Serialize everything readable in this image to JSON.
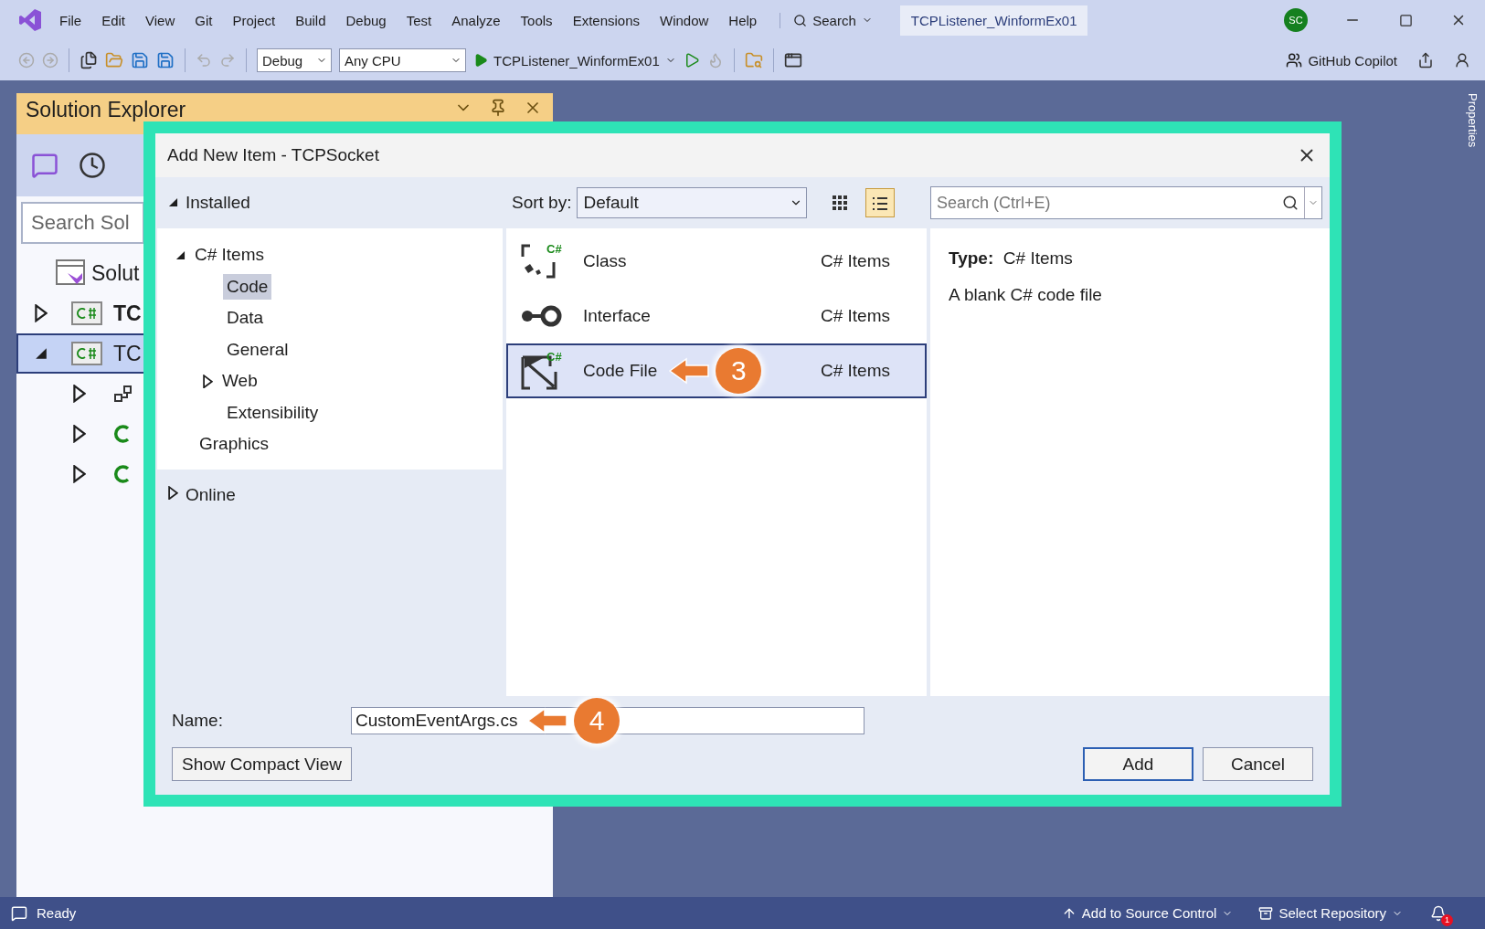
{
  "menu_bar": {
    "items": [
      "File",
      "Edit",
      "View",
      "Git",
      "Project",
      "Build",
      "Debug",
      "Test",
      "Analyze",
      "Tools",
      "Extensions",
      "Window",
      "Help"
    ],
    "search": "Search",
    "solution_title": "TCPListener_WinformEx01",
    "avatar": "SC"
  },
  "toolbar": {
    "configuration": "Debug",
    "platform": "Any CPU",
    "start_target": "TCPListener_WinformEx01",
    "copilot": "GitHub Copilot"
  },
  "side_tab": "Properties",
  "solution_explorer": {
    "title": "Solution Explorer",
    "search_placeholder": "Search Sol",
    "rows": [
      {
        "kind": "solution",
        "label": "Solut",
        "selected": false
      },
      {
        "kind": "project",
        "label": "TC",
        "bold": true,
        "expanded": false,
        "selected": false
      },
      {
        "kind": "project",
        "label": "TC",
        "bold": false,
        "expanded": true,
        "selected": true
      },
      {
        "kind": "dependencies",
        "expanded": false,
        "selected": false
      },
      {
        "kind": "file",
        "expanded": false,
        "selected": false
      },
      {
        "kind": "file",
        "expanded": false,
        "selected": false
      }
    ]
  },
  "dialog": {
    "title": "Add New Item - TCPSocket",
    "installed": {
      "label": "Installed",
      "expanded": true,
      "children": [
        {
          "label": "C# Items",
          "expanded": true,
          "selected": false,
          "children": [
            {
              "label": "Code",
              "selected": true
            },
            {
              "label": "Data",
              "selected": false
            },
            {
              "label": "General",
              "selected": false
            },
            {
              "label": "Web",
              "selected": false,
              "expanded": false
            },
            {
              "label": "Extensibility",
              "selected": false
            }
          ]
        },
        {
          "label": "Graphics",
          "selected": false
        }
      ]
    },
    "online": {
      "label": "Online",
      "expanded": false
    },
    "sort": {
      "label": "Sort by:",
      "value": "Default"
    },
    "view_buttons": [
      {
        "kind": "grid",
        "selected": false
      },
      {
        "kind": "list",
        "selected": true
      }
    ],
    "search_placeholder": "Search (Ctrl+E)",
    "templates": [
      {
        "kind": "class",
        "name": "Class",
        "category": "C# Items",
        "selected": false,
        "icon_badge": "C#"
      },
      {
        "kind": "interface",
        "name": "Interface",
        "category": "C# Items",
        "selected": false
      },
      {
        "kind": "codefile",
        "name": "Code File",
        "category": "C# Items",
        "selected": true,
        "icon_badge": "C#",
        "callout": "3"
      }
    ],
    "details": {
      "type_label": "Type:",
      "type_value": "C# Items",
      "description": "A blank C# code file"
    },
    "name_field": {
      "label": "Name:",
      "value": "CustomEventArgs.cs",
      "callout": "4"
    },
    "compact_button": "Show Compact View",
    "buttons": [
      {
        "label": "Add",
        "default": true
      },
      {
        "label": "Cancel",
        "default": false
      }
    ]
  },
  "status_bar": {
    "status": "Ready",
    "source_control": "Add to Source Control",
    "repository": "Select Repository",
    "notifications": "1"
  }
}
